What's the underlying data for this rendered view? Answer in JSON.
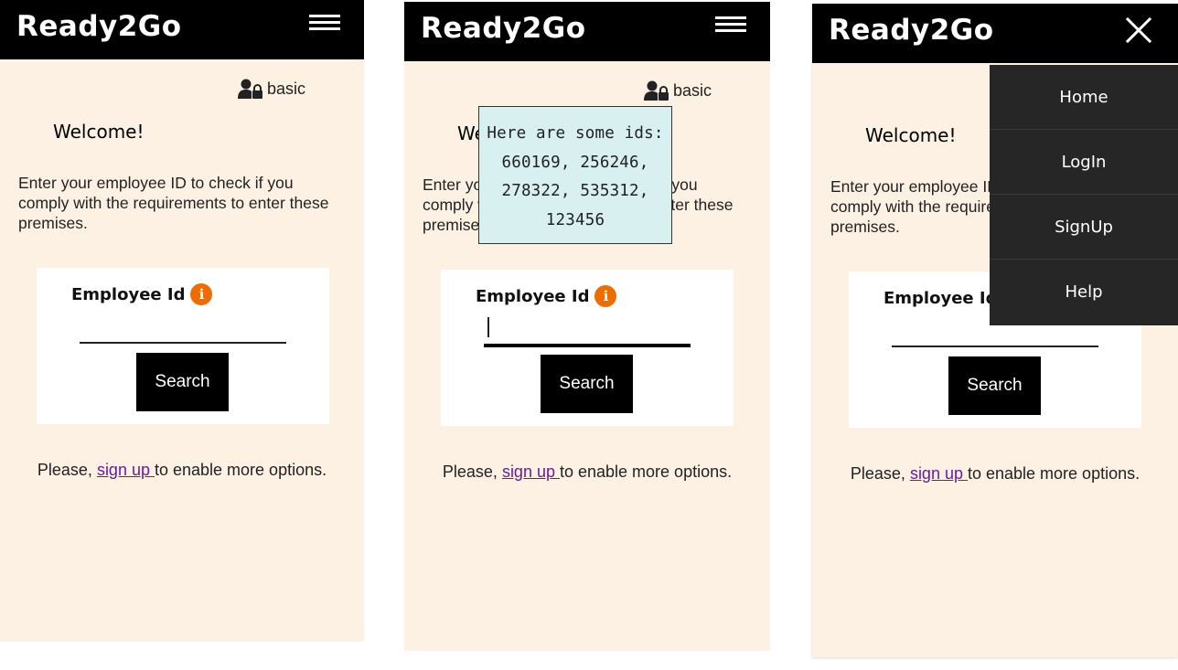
{
  "app": {
    "brand": "Ready2Go",
    "user_role": "basic"
  },
  "home": {
    "welcome": "Welcome!",
    "intro": "Enter your employee ID to check if you comply with the requirements to enter these premises.",
    "field_label": "Employee Id",
    "input_value": "",
    "search_label": "Search",
    "footer_prefix": "Please, ",
    "footer_link": "sign up ",
    "footer_suffix": "to enable more options."
  },
  "tooltip": {
    "lines": [
      "Here are some ids:",
      "660169, 256246,",
      "278322, 535312,",
      "123456"
    ]
  },
  "menu": {
    "items": [
      {
        "label": "Home"
      },
      {
        "label": "LogIn"
      },
      {
        "label": "SignUp"
      },
      {
        "label": "Help"
      }
    ]
  },
  "colors": {
    "app_bar": "#000000",
    "page_background": "#fdf1e4",
    "info_icon": "#ef6c00",
    "link": "#6a1b9a",
    "tooltip_background": "#d8f0f0",
    "menu_background": "#262626"
  },
  "icons": {
    "menu": "hamburger-icon",
    "close": "close-icon",
    "user": "user-lock-icon",
    "info": "info-icon"
  }
}
